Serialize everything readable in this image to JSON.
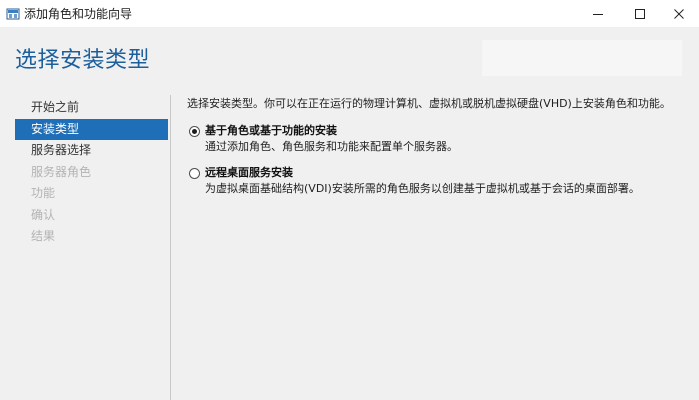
{
  "window": {
    "title": "添加角色和功能向导",
    "app_icon": "server-manager-icon",
    "controls": {
      "minimize": "minimize-icon",
      "maximize": "maximize-icon",
      "close": "close-icon"
    }
  },
  "header": {
    "page_title": "选择安装类型"
  },
  "nav": {
    "items": [
      {
        "label": "开始之前",
        "state": "normal"
      },
      {
        "label": "安装类型",
        "state": "active"
      },
      {
        "label": "服务器选择",
        "state": "normal"
      },
      {
        "label": "服务器角色",
        "state": "disabled"
      },
      {
        "label": "功能",
        "state": "disabled"
      },
      {
        "label": "确认",
        "state": "disabled"
      },
      {
        "label": "结果",
        "state": "disabled"
      }
    ]
  },
  "content": {
    "description": "选择安装类型。你可以在正在运行的物理计算机、虚拟机或脱机虚拟硬盘(VHD)上安装角色和功能。",
    "options": [
      {
        "label": "基于角色或基于功能的安装",
        "description": "通过添加角色、角色服务和功能来配置单个服务器。",
        "selected": true
      },
      {
        "label": "远程桌面服务安装",
        "description": "为虚拟桌面基础结构(VDI)安装所需的角色服务以创建基于虚拟机或基于会话的桌面部署。",
        "selected": false
      }
    ]
  },
  "colors": {
    "accent": "#1f6fb8",
    "title": "#1c5f9d",
    "disabled_text": "#b3b3b3",
    "background": "#f0f0f0"
  }
}
